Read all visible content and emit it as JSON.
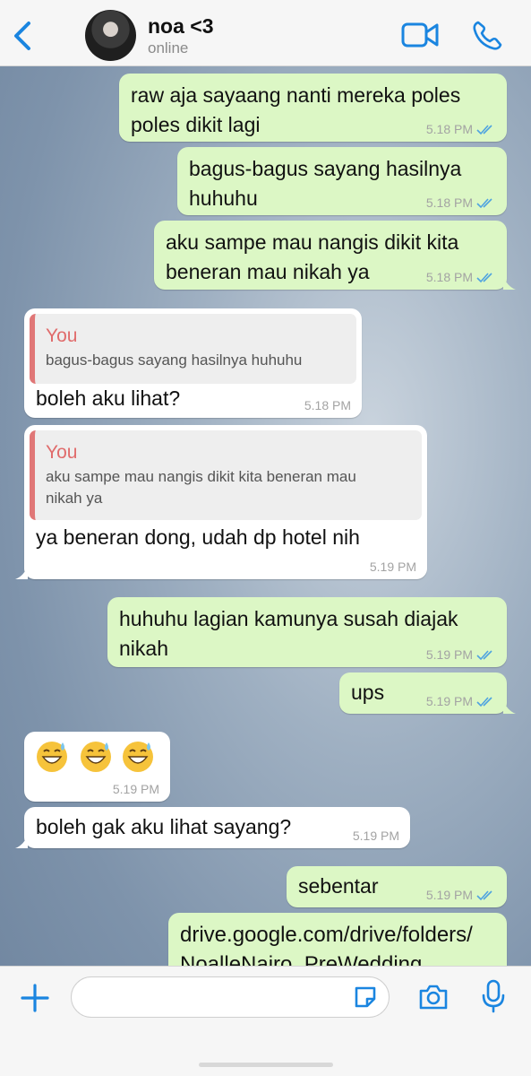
{
  "header": {
    "contact_name": "noa <3",
    "status": "online",
    "icons": [
      "back-chevron-icon",
      "video-call-icon",
      "phone-call-icon"
    ],
    "accent_color": "#1a85e0"
  },
  "messages": [
    {
      "direction": "out",
      "text_lines": [
        "raw aja sayaang nanti mereka poles",
        "poles dikit lagi"
      ],
      "time": "5.18 PM",
      "read": true
    },
    {
      "direction": "out",
      "text_lines": [
        "bagus-bagus sayang hasilnya",
        "huhuhu"
      ],
      "time": "5.18 PM",
      "read": true
    },
    {
      "direction": "out",
      "text_lines": [
        "aku sampe mau nangis dikit kita",
        "beneran mau nikah ya"
      ],
      "time": "5.18 PM",
      "read": true
    },
    {
      "direction": "in",
      "quote": {
        "author": "You",
        "text_lines": [
          "bagus-bagus sayang hasilnya huhuhu"
        ]
      },
      "text": "boleh aku lihat?",
      "time": "5.18 PM"
    },
    {
      "direction": "in",
      "quote": {
        "author": "You",
        "text_lines": [
          "aku sampe mau nangis dikit kita beneran mau",
          "nikah ya"
        ]
      },
      "text": "ya beneran dong, udah dp hotel nih",
      "time": "5.19 PM"
    },
    {
      "direction": "out",
      "text_lines": [
        "huhuhu lagian kamunya susah diajak",
        "nikah"
      ],
      "time": "5.19 PM",
      "read": true
    },
    {
      "direction": "out",
      "text_lines": [
        "ups"
      ],
      "time": "5.19 PM",
      "read": true
    },
    {
      "direction": "in",
      "emoji": [
        "grinning-sweat-emoji",
        "grinning-sweat-emoji",
        "grinning-sweat-emoji"
      ],
      "time": "5.19 PM"
    },
    {
      "direction": "in",
      "text": "boleh gak aku lihat sayang?",
      "time": "5.19 PM"
    },
    {
      "direction": "out",
      "text_lines": [
        "sebentar"
      ],
      "time": "5.19 PM",
      "read": true
    },
    {
      "direction": "out",
      "text_lines": [
        "drive.google.com/drive/folders/",
        "NoalleNairo_PreWedding"
      ],
      "link": true
    }
  ],
  "colors": {
    "outgoing_bubble": "#dcf7c5",
    "incoming_bubble": "#ffffff",
    "read_ticks": "#4fa3e0",
    "quote_author": "#e06b6b"
  },
  "composer": {
    "input_value": "",
    "icons": [
      "plus-icon",
      "sticker-icon",
      "camera-icon",
      "microphone-icon"
    ]
  }
}
